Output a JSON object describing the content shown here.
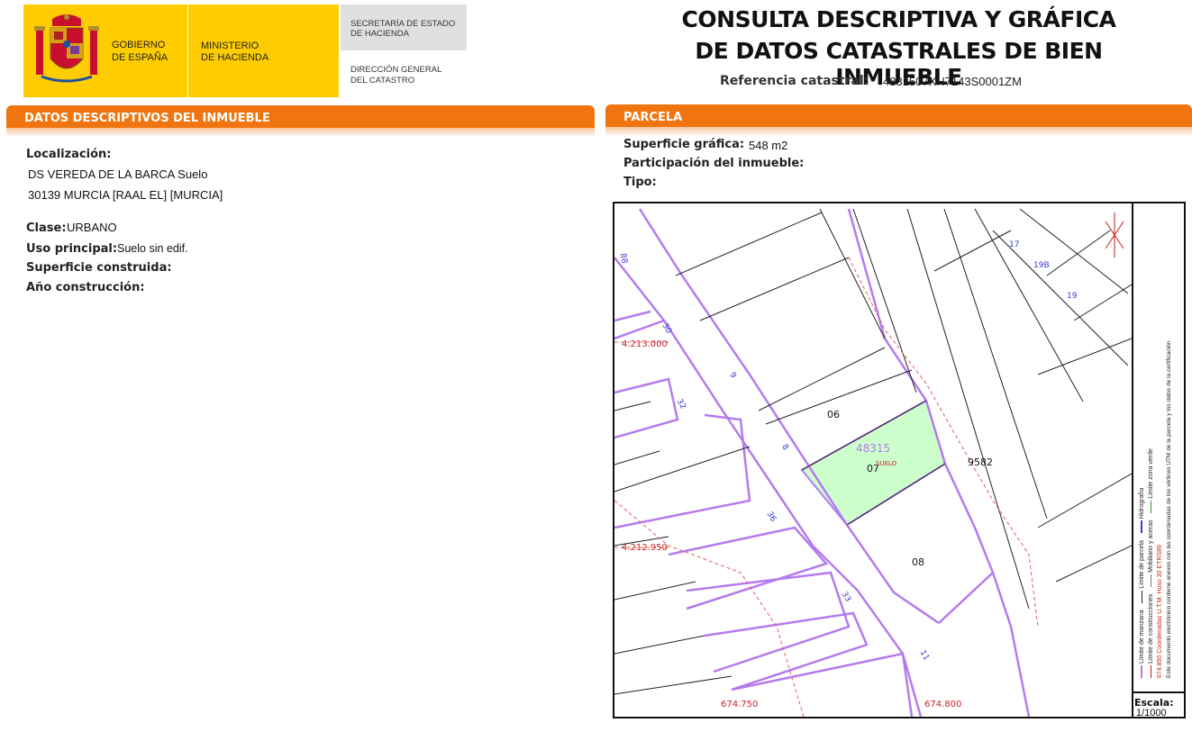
{
  "header": {
    "gov_line1": "GOBIERNO",
    "gov_line2": "DE ESPAÑA",
    "min_line1": "MINISTERIO",
    "min_line2": "DE HACIENDA",
    "sec_line1": "SECRETARÍA DE ESTADO",
    "sec_line2": "DE HACIENDA",
    "dir_line1": "DIRECCIÓN GENERAL",
    "dir_line2": "DEL CATASTRO",
    "title_line1": "CONSULTA DESCRIPTIVA Y GRÁFICA",
    "title_line2": "DE DATOS CATASTRALES DE BIEN INMUEBLE",
    "ref_label": "Referencia catastral:",
    "ref_value": "4831507XH7143S0001ZM"
  },
  "descriptivos": {
    "heading": "DATOS DESCRIPTIVOS DEL INMUEBLE",
    "localizacion_label": "Localización:",
    "localizacion_line1": "DS VEREDA DE LA BARCA  Suelo",
    "localizacion_line2": "30139 MURCIA [RAAL EL] [MURCIA]",
    "clase_label": "Clase:",
    "clase_value": "URBANO",
    "uso_label": "Uso principal:",
    "uso_value": "Suelo sin edif.",
    "superficie_label": "Superficie construida:",
    "anio_label": "Año construcción:"
  },
  "parcela": {
    "heading": "PARCELA",
    "superficie_label": "Superficie gráfica:",
    "superficie_value": "548 m2",
    "participacion_label": "Participación del inmueble:",
    "tipo_label": "Tipo:"
  },
  "map": {
    "parcel_numbers": [
      "06",
      "07",
      "08",
      "9582",
      "48315",
      "SUELO"
    ],
    "street_numbers": [
      "30",
      "32",
      "36",
      "33",
      "11",
      "17",
      "19B",
      "19",
      "8",
      "9",
      "88"
    ],
    "coord_y1": "4.213.000",
    "coord_y2": "4.212.950",
    "coord_x1": "674.750",
    "coord_x2": "674.800",
    "legend": {
      "manzana": "Límite de manzana",
      "parcela": "Límite de parcela",
      "hidrografia": "Hidrografía",
      "construcciones": "Límite de construcciones",
      "mobiliario": "Mobiliario y aceras",
      "zona_verde": "Límite zona verde",
      "utm": "674.850 Coordenadas U.T.M. Huso 30 ETRS89",
      "nota": "Este documento electrónico contiene anexos con las coordenadas de los vértices UTM de la parcela y los datos de la certificación"
    },
    "scale_label": "Escala:",
    "scale_value": "1/1000"
  },
  "colors": {
    "accent_orange": "#f07510",
    "gov_yellow": "#ffcc00",
    "parcel_green": "#ccffcc",
    "manzana_violet": "#b57bee",
    "coord_red": "#cc2222"
  }
}
